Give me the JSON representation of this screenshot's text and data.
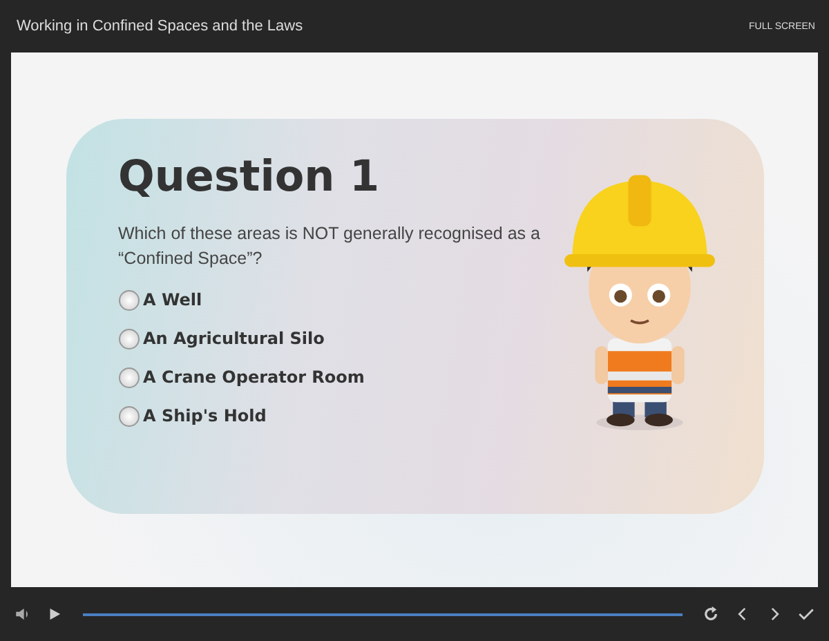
{
  "window": {
    "title": "Working in Confined Spaces and the Laws",
    "fullscreen_label": "FULL SCREEN"
  },
  "question": {
    "heading": "Question 1",
    "prompt": "Which of these areas is NOT generally recognised as a “Confined Space”?",
    "options": [
      {
        "label": "A Well",
        "selected": false
      },
      {
        "label": "An Agricultural Silo",
        "selected": false
      },
      {
        "label": "A Crane Operator Room",
        "selected": false
      },
      {
        "label": "A Ship's Hold",
        "selected": false
      }
    ]
  },
  "player": {
    "progress": {
      "level": 1
    }
  }
}
